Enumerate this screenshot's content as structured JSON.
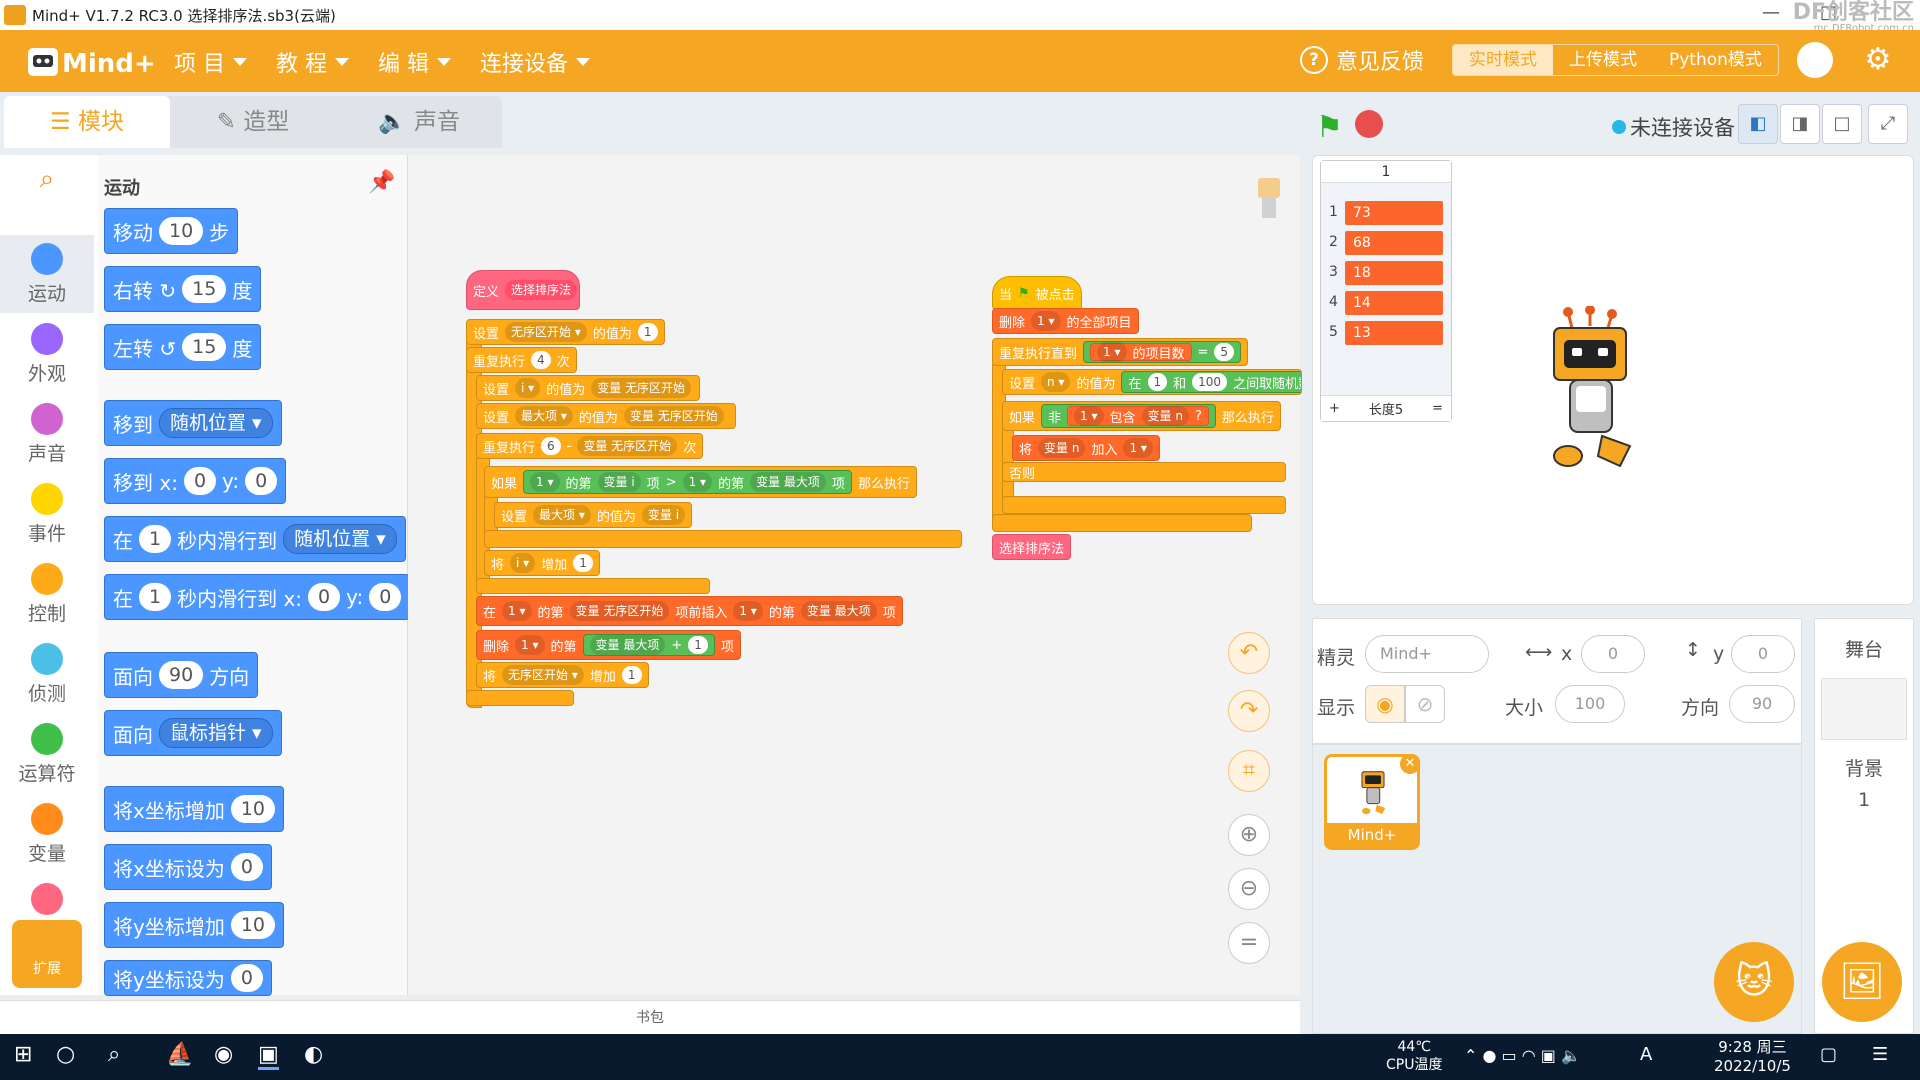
{
  "window": {
    "title": "Mind+ V1.7.2 RC3.0    选择排序法.sb3(云端)",
    "min": "—",
    "max": "□",
    "watermark": "DF创客社区",
    "watermark_url": "mc.DFRobot.com.cn"
  },
  "menubar": {
    "logo": "Mind+",
    "items": [
      "项 目",
      "教 程",
      "编 辑",
      "连接设备"
    ],
    "feedback": "意见反馈",
    "modes": [
      "实时模式",
      "上传模式",
      "Python模式"
    ]
  },
  "tabs": [
    "模块",
    "造型",
    "声音"
  ],
  "stage_controls": {
    "connection": "未连接设备"
  },
  "categories": [
    {
      "label": "",
      "color": "#ff8c1a"
    },
    {
      "label": "运动",
      "color": "#4c97ff"
    },
    {
      "label": "外观",
      "color": "#9966ff"
    },
    {
      "label": "声音",
      "color": "#cf63cf"
    },
    {
      "label": "事件",
      "color": "#ffd500"
    },
    {
      "label": "控制",
      "color": "#ffab19"
    },
    {
      "label": "侦测",
      "color": "#4cbfe6"
    },
    {
      "label": "运算符",
      "color": "#40bf4a"
    },
    {
      "label": "变量",
      "color": "#ff8c1a"
    },
    {
      "label": "",
      "color": "#ff6680"
    }
  ],
  "extension_label": "扩展",
  "palette": {
    "title": "运动",
    "blocks": [
      {
        "t1": "移动",
        "v": "10",
        "t2": "步"
      },
      {
        "t1": "右转 ↻",
        "v": "15",
        "t2": "度"
      },
      {
        "t1": "左转 ↺",
        "v": "15",
        "t2": "度"
      },
      {
        "t1": "移到",
        "d": "随机位置 ▾"
      },
      {
        "t1": "移到 x:",
        "v": "0",
        "t2": "y:",
        "v2": "0"
      },
      {
        "t1": "在",
        "v": "1",
        "t2": "秒内滑行到",
        "d": "随机位置 ▾"
      },
      {
        "t1": "在",
        "v": "1",
        "t2": "秒内滑行到 x:",
        "v2": "0",
        "t3": "y:",
        "v3": "0"
      },
      {
        "t1": "面向",
        "v": "90",
        "t2": "方向"
      },
      {
        "t1": "面向",
        "d": "鼠标指针 ▾"
      },
      {
        "t1": "将x坐标增加",
        "v": "10"
      },
      {
        "t1": "将x坐标设为",
        "v": "0"
      },
      {
        "t1": "将y坐标增加",
        "v": "10"
      },
      {
        "t1": "将y坐标设为",
        "v": "0"
      }
    ]
  },
  "script1": {
    "define": "定义",
    "define_name": "选择排序法",
    "set1": {
      "a": "设置",
      "var": "无序区开始 ▾",
      "b": "的值为",
      "v": "1"
    },
    "repeat": {
      "a": "重复执行",
      "v": "4",
      "b": "次"
    },
    "set_i": {
      "a": "设置",
      "var": "i ▾",
      "b": "的值为",
      "c": "变量 无序区开始"
    },
    "set_max": {
      "a": "设置",
      "var": "最大项 ▾",
      "b": "的值为",
      "c": "变量 无序区开始"
    },
    "repeat2": {
      "a": "重复执行",
      "v": "6",
      "op": "-",
      "c": "变量 无序区开始",
      "b": "次"
    },
    "if": {
      "a": "如果",
      "l1": "1 ▾",
      "l2": "的第",
      "l3": "变量 i",
      "l4": "项",
      "gt": ">",
      "r1": "1 ▾",
      "r2": "的第",
      "r3": "变量 最大项",
      "r4": "项",
      "then": "那么执行"
    },
    "set_max2": {
      "a": "设置",
      "var": "最大项 ▾",
      "b": "的值为",
      "c": "变量 i"
    },
    "inc_i": {
      "a": "将",
      "var": "i ▾",
      "b": "增加",
      "v": "1"
    },
    "insert": {
      "a": "在",
      "l": "1 ▾",
      "b": "的第",
      "c": "变量 无序区开始",
      "d": "项前插入",
      "l2": "1 ▾",
      "e": "的第",
      "f": "变量 最大项",
      "g": "项"
    },
    "delete": {
      "a": "删除",
      "l": "1 ▾",
      "b": "的第",
      "c": "变量 最大项",
      "op": "+",
      "v": "1",
      "d": "项"
    },
    "inc_start": {
      "a": "将",
      "var": "无序区开始 ▾",
      "b": "增加",
      "v": "1"
    }
  },
  "script2": {
    "hat": {
      "a": "当",
      "b": "被点击"
    },
    "delall": {
      "a": "删除",
      "l": "1 ▾",
      "b": "的全部项目"
    },
    "until": {
      "a": "重复执行直到",
      "l": "1 ▾",
      "b": "的项目数",
      "eq": "=",
      "v": "5"
    },
    "setn": {
      "a": "设置",
      "var": "n ▾",
      "b": "的值为",
      "c": "在",
      "v1": "1",
      "d": "和",
      "v2": "100",
      "e": "之间取随机数"
    },
    "if": {
      "a": "如果",
      "not": "非",
      "l": "1 ▾",
      "b": "包含",
      "c": "变量 n",
      "q": "?",
      "then": "那么执行"
    },
    "add": {
      "a": "将",
      "c": "变量 n",
      "b": "加入",
      "l": "1 ▾"
    },
    "else": "否则",
    "call": "选择排序法"
  },
  "bag": "书包",
  "list_monitor": {
    "title": "1",
    "items": [
      "73",
      "68",
      "18",
      "14",
      "13"
    ],
    "plus": "+",
    "length": "长度5",
    "eq": "="
  },
  "sprite_info": {
    "sprite_label": "精灵",
    "sprite_name": "Mind+",
    "x_label": "x",
    "x": "0",
    "y_label": "y",
    "y": "0",
    "show_label": "显示",
    "size_label": "大小",
    "size": "100",
    "dir_label": "方向",
    "dir": "90"
  },
  "sprites": [
    {
      "name": "Mind+"
    }
  ],
  "stage_panel": {
    "title": "舞台",
    "bg_label": "背景",
    "bg_count": "1"
  },
  "taskbar": {
    "temp": "44℃",
    "temp_label": "CPU温度",
    "time": "9:28 周三",
    "date": "2022/10/5",
    "ime": "A"
  }
}
